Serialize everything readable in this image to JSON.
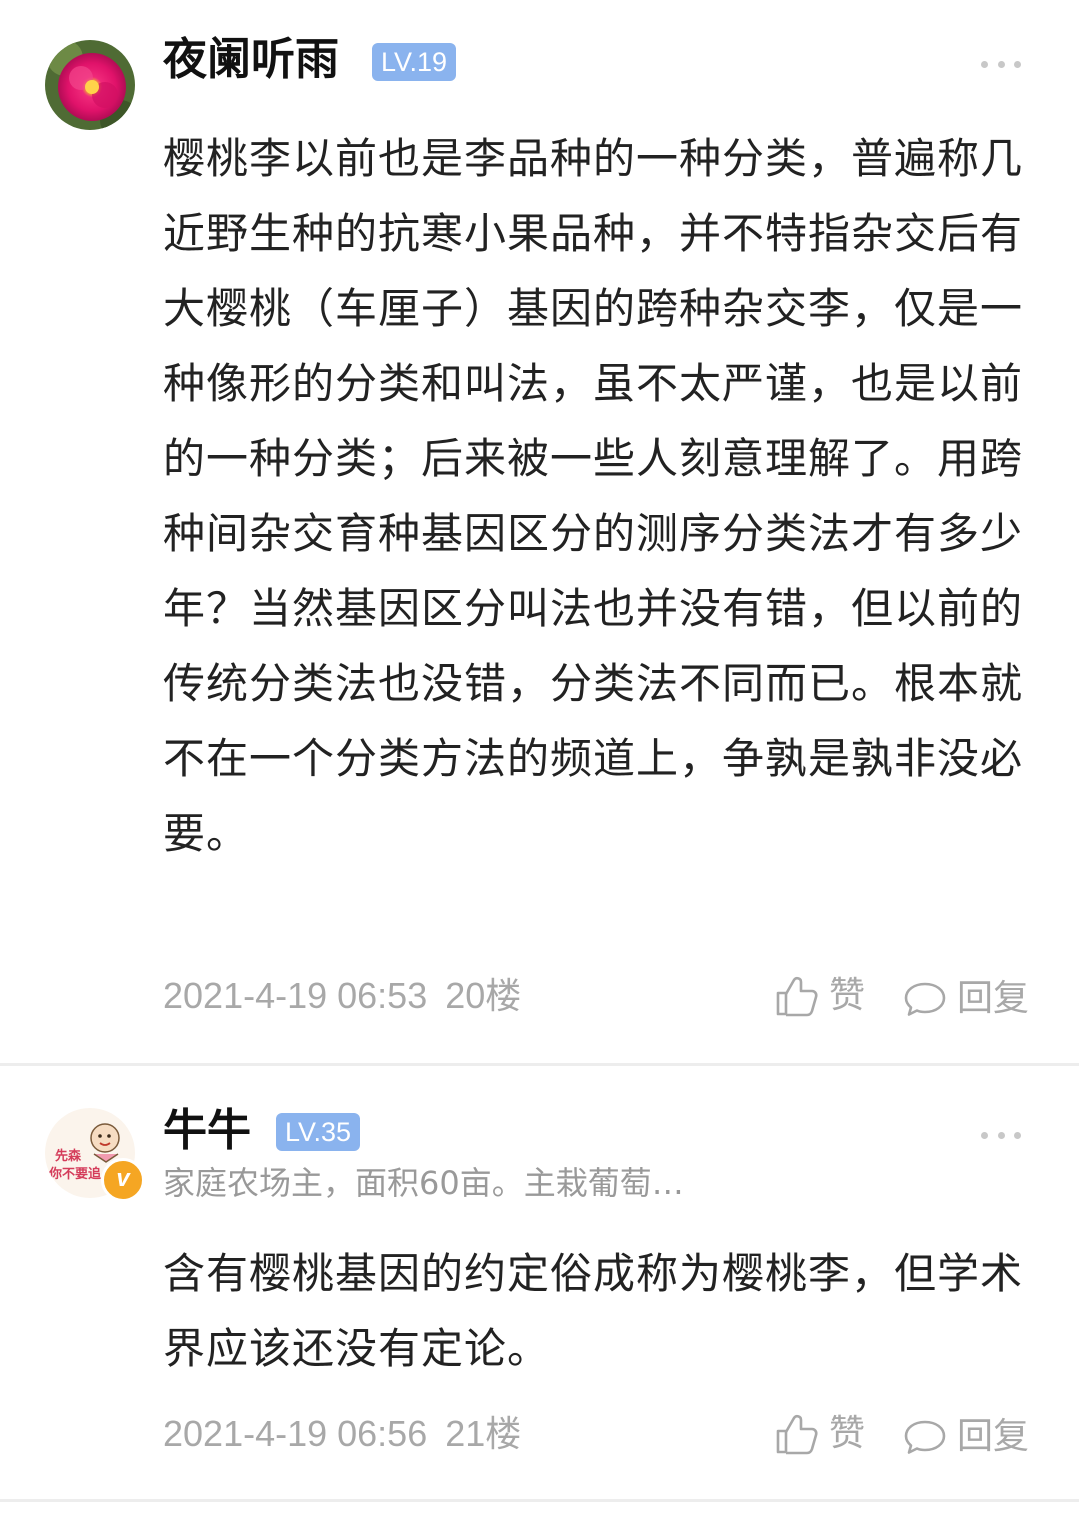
{
  "comments": [
    {
      "username": "夜阑听雨",
      "level": "LV.19",
      "text": "樱桃李以前也是李品种的一种分类，普遍称几近野生种的抗寒小果品种，并不特指杂交后有大樱桃（车厘子）基因的跨种杂交李，仅是一种像形的分类和叫法，虽不太严谨，也是以前的一种分类；后来被一些人刻意理解了。用跨种间杂交育种基因区分的测序分类法才有多少年？当然基因区分叫法也并没有错，但以前的传统分类法也没错，分类法不同而已。根本就不在一个分类方法的频道上，争孰是孰非没必要。",
      "datetime": "2021-4-19 06:53",
      "floor": "20楼",
      "like_label": "赞",
      "reply_label": "回复",
      "avatar_icon": "pink-flower-avatar"
    },
    {
      "username": "牛牛",
      "level": "LV.35",
      "subtitle": "家庭农场主，面积60亩。主栽葡萄…",
      "verified_badge": "v",
      "avatar_text": "先森你不要追我",
      "text": "含有樱桃基因的约定俗成称为樱桃李，但学术界应该还没有定论。",
      "datetime": "2021-4-19 06:56",
      "floor": "21楼",
      "like_label": "赞",
      "reply_label": "回复",
      "avatar_icon": "cartoon-character-avatar"
    }
  ],
  "colors": {
    "level_badge": "#8ab3ee",
    "meta_text": "#a8a8a8",
    "verified_badge": "#f5a623"
  }
}
